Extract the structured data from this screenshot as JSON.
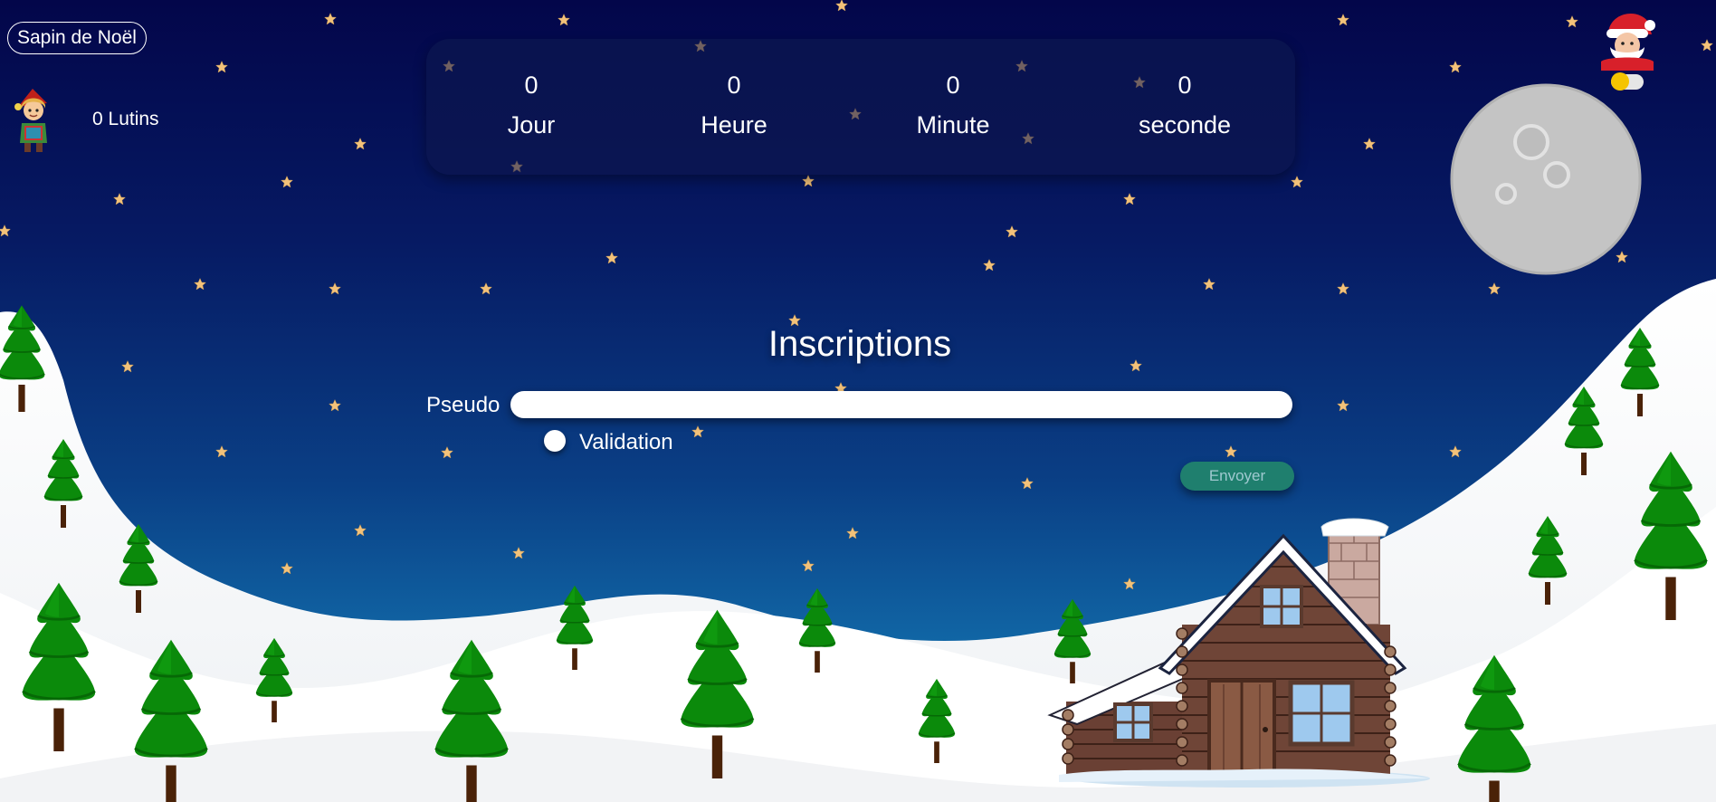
{
  "header": {
    "title": "Sapin de Noël"
  },
  "elves": {
    "count_text": "0 Lutins"
  },
  "countdown": {
    "days": {
      "value": "0",
      "label": "Jour"
    },
    "hours": {
      "value": "0",
      "label": "Heure"
    },
    "minutes": {
      "value": "0",
      "label": "Minute"
    },
    "seconds": {
      "value": "0",
      "label": "seconde"
    }
  },
  "form": {
    "title": "Inscriptions",
    "pseudo_label": "Pseudo",
    "pseudo_value": "",
    "validation_label": "Validation",
    "submit_label": "Envoyer"
  },
  "icons": {
    "elf": "elf-icon",
    "santa": "santa-icon",
    "theme_toggle": "moon-toggle-icon",
    "moon": "moon-icon",
    "house": "log-cabin-icon",
    "tree": "pine-tree-icon",
    "star": "star-icon"
  },
  "colors": {
    "sky_top": "#03064a",
    "sky_bottom": "#1479b5",
    "snow": "#ffffff",
    "tree": "#0b8a0b",
    "star": "#f3c27a",
    "button": "#1f7f6e",
    "moon": "#c8c8c8"
  }
}
